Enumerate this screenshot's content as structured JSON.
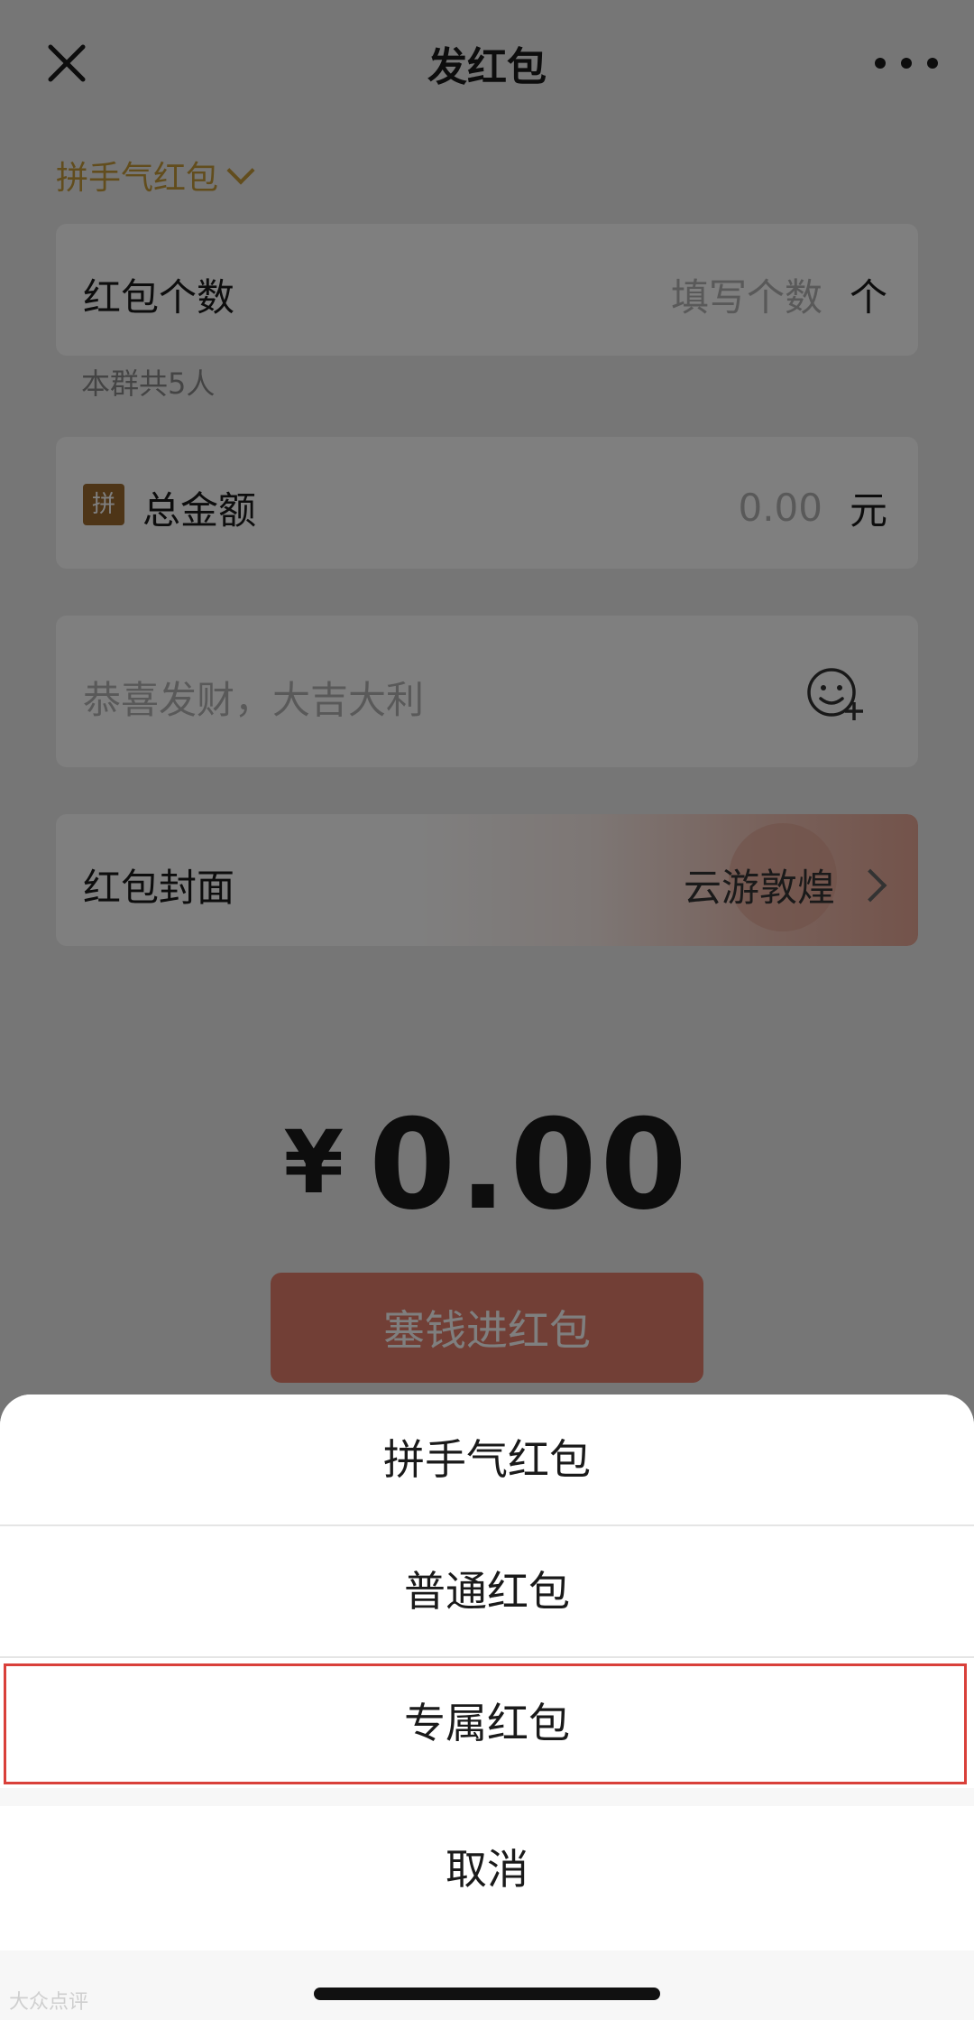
{
  "header": {
    "title": "发红包",
    "close_icon": "close-icon",
    "more_icon": "more-dots-icon"
  },
  "type_selector": {
    "label": "拼手气红包"
  },
  "count_row": {
    "label": "红包个数",
    "placeholder": "填写个数",
    "unit": "个",
    "hint": "本群共5人"
  },
  "amount_row": {
    "badge": "拼",
    "label": "总金额",
    "value": "0.00",
    "unit": "元"
  },
  "message_row": {
    "placeholder": "恭喜发财，大吉大利"
  },
  "cover_row": {
    "label": "红包封面",
    "value": "云游敦煌"
  },
  "total": {
    "currency": "¥",
    "amount": "0.00"
  },
  "send_button": {
    "label": "塞钱进红包"
  },
  "sheet": {
    "options": [
      {
        "label": "拼手气红包"
      },
      {
        "label": "普通红包"
      },
      {
        "label": "专属红包"
      }
    ],
    "cancel": "取消"
  },
  "watermark": "大众点评",
  "colors": {
    "accent_gold": "#c59a3a",
    "button": "#e57f6c",
    "highlight_border": "#d9403a"
  }
}
